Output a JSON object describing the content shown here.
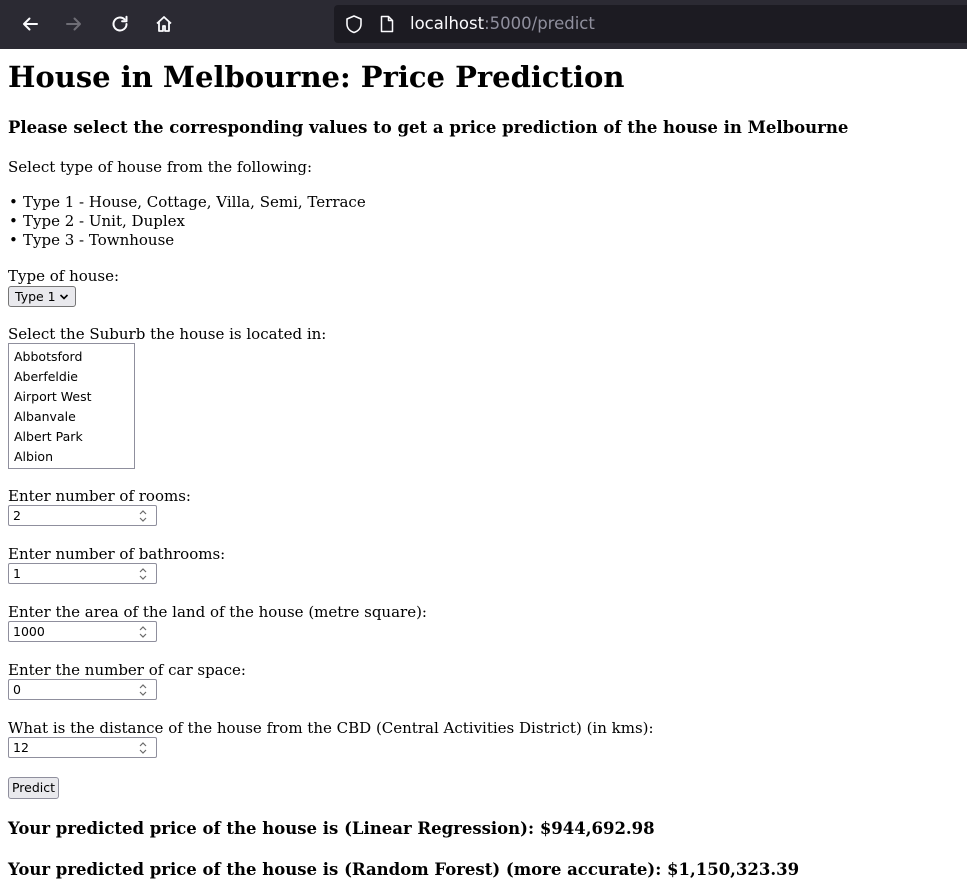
{
  "browser": {
    "url_host": "localhost",
    "url_path": ":5000/predict"
  },
  "page": {
    "title": "House in Melbourne: Price Prediction",
    "subtitle": "Please select the corresponding values to get a price prediction of the house in Melbourne",
    "type_intro": "Select type of house from the following:",
    "type_list": [
      "Type 1 - House, Cottage, Villa, Semi, Terrace",
      "Type 2 - Unit, Duplex",
      "Type 3 - Townhouse"
    ]
  },
  "form": {
    "house_type_label": "Type of house:",
    "house_type_value": "Type 1",
    "suburb_label": "Select the Suburb the house is located in:",
    "suburb_options": [
      "Abbotsford",
      "Aberfeldie",
      "Airport West",
      "Albanvale",
      "Albert Park",
      "Albion"
    ],
    "rooms_label": "Enter number of rooms:",
    "rooms_value": "2",
    "bathrooms_label": "Enter number of bathrooms:",
    "bathrooms_value": "1",
    "land_label": "Enter the area of the land of the house (metre square):",
    "land_value": "1000",
    "car_label": "Enter the number of car space:",
    "car_value": "0",
    "distance_label": "What is the distance of the house from the CBD (Central Activities District) (in kms):",
    "distance_value": "12",
    "predict_label": "Predict"
  },
  "results": {
    "linear": "Your predicted price of the house is (Linear Regression): $944,692.98",
    "forest": "Your predicted price of the house is (Random Forest) (more accurate): $1,150,323.39"
  },
  "icons": {
    "back": "arrow-left-icon",
    "forward": "arrow-right-icon",
    "reload": "reload-icon",
    "home": "home-icon",
    "tracking": "shield-icon",
    "page": "page-icon"
  },
  "colors": {
    "chrome_bg": "#2b2a33",
    "urlbar_bg": "#1c1b22"
  }
}
